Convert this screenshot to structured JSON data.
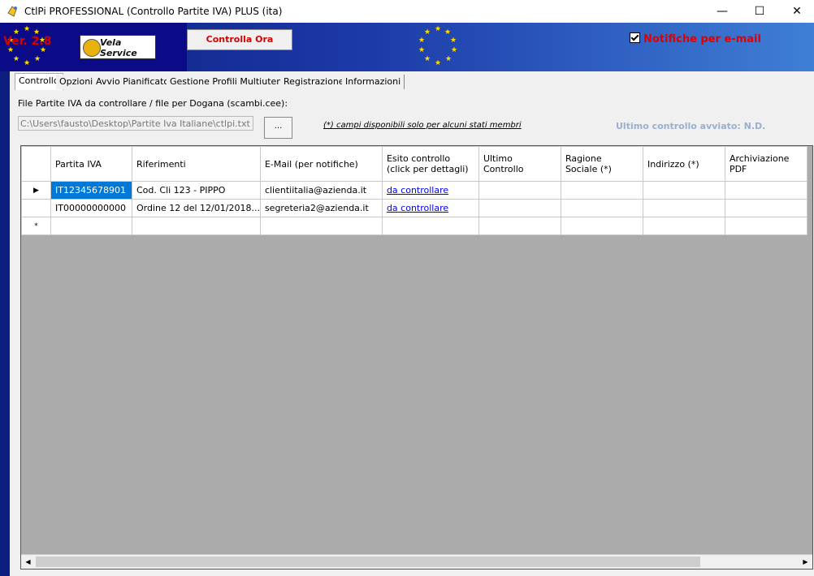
{
  "window": {
    "title": "CtlPi PROFESSIONAL (Controllo Partite IVA) PLUS (ita)",
    "minimize": "—",
    "maximize": "☐",
    "close": "✕"
  },
  "banner": {
    "version": "Ver. 2.8",
    "logo_text": "Vela Service",
    "check_now_button": "Controlla Ora",
    "email_notifications_label": "Notifiche per e-mail",
    "email_notifications_checked": true
  },
  "tabs": [
    "Controllo",
    "Opzioni",
    "Avvio Pianificato",
    "Gestione Profili Multiutenza",
    "Registrazione",
    "Informazioni"
  ],
  "active_tab": "Controllo",
  "file_section": {
    "label": "File Partite IVA da controllare / file per Dogana (scambi.cee):",
    "path": "C:\\Users\\fausto\\Desktop\\Partite Iva Italiane\\ctlpi.txt",
    "browse_label": "...",
    "note": "(*) campi disponibili solo per alcuni stati membri",
    "last_check": "Ultimo controllo avviato: N.D."
  },
  "grid": {
    "columns": [
      {
        "line1": "Partita IVA",
        "line2": ""
      },
      {
        "line1": "Riferimenti",
        "line2": ""
      },
      {
        "line1": "E-Mail (per notifiche)",
        "line2": ""
      },
      {
        "line1": "Esito controllo",
        "line2": "(click per dettagli)"
      },
      {
        "line1": "Ultimo",
        "line2": "Controllo"
      },
      {
        "line1": "Ragione",
        "line2": "Sociale (*)"
      },
      {
        "line1": "Indirizzo (*)",
        "line2": ""
      },
      {
        "line1": "Archiviazione",
        "line2": "PDF"
      }
    ],
    "rows": [
      {
        "marker": "▶",
        "piva": "IT12345678901",
        "rif": "Cod. Cli 123 - PIPPO",
        "email": "clientiitalia@azienda.it",
        "esito": "da controllare",
        "ultimo": "",
        "ragione": "",
        "indirizzo": "",
        "pdf": ""
      },
      {
        "marker": "",
        "piva": "IT00000000000",
        "rif": "Ordine 12 del 12/01/2018...",
        "email": "segreteria2@azienda.it",
        "esito": "da controllare",
        "ultimo": "",
        "ragione": "",
        "indirizzo": "",
        "pdf": ""
      },
      {
        "marker": "*",
        "piva": "",
        "rif": "",
        "email": "",
        "esito": "",
        "ultimo": "",
        "ragione": "",
        "indirizzo": "",
        "pdf": ""
      }
    ]
  },
  "colors": {
    "banner_dark": "#0b0b88",
    "banner_light": "#3f7fd6",
    "accent_red": "#e00000",
    "selection": "#0078d7",
    "grid_background": "#ababab"
  }
}
